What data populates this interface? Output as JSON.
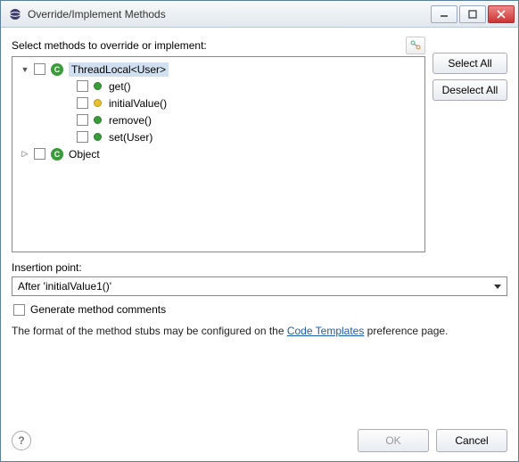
{
  "window": {
    "title": "Override/Implement Methods"
  },
  "header": {
    "label": "Select methods to override or implement:"
  },
  "tree": {
    "items": [
      {
        "expander": "▼",
        "indent": 0,
        "checkbox": true,
        "icon": "class",
        "label": "ThreadLocal<User>",
        "selected": true
      },
      {
        "expander": "",
        "indent": 48,
        "checkbox": true,
        "icon": "meth-green",
        "label": "get()"
      },
      {
        "expander": "",
        "indent": 48,
        "checkbox": true,
        "icon": "meth-yellow",
        "label": "initialValue()"
      },
      {
        "expander": "",
        "indent": 48,
        "checkbox": true,
        "icon": "meth-green",
        "label": "remove()"
      },
      {
        "expander": "",
        "indent": 48,
        "checkbox": true,
        "icon": "meth-green",
        "label": "set(User)"
      },
      {
        "expander": "▷",
        "indent": 0,
        "checkbox": true,
        "icon": "class",
        "label": "Object"
      }
    ]
  },
  "sidebar": {
    "select_all": "Select All",
    "deselect_all": "Deselect All"
  },
  "insertion": {
    "label": "Insertion point:",
    "value": "After 'initialValue1()'"
  },
  "generate_comments": {
    "label": "Generate method comments"
  },
  "format_note": {
    "prefix": "The format of the method stubs may be configured on the ",
    "link": "Code Templates",
    "suffix": " preference page."
  },
  "footer": {
    "ok": "OK",
    "cancel": "Cancel"
  }
}
